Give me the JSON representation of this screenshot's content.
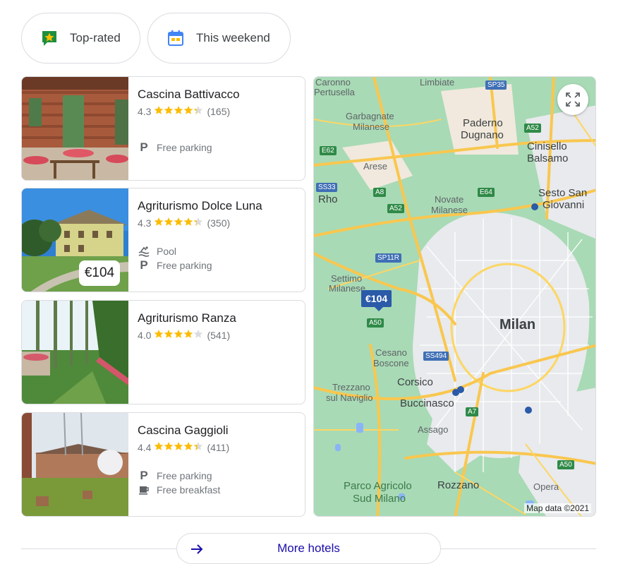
{
  "chips": [
    {
      "label": "Top-rated",
      "icon": "star-badge-icon"
    },
    {
      "label": "This weekend",
      "icon": "calendar-icon"
    }
  ],
  "hotels": [
    {
      "name": "Cascina Battivacco",
      "rating": "4.3",
      "stars": 4.3,
      "reviews": "(165)",
      "amenities": [
        {
          "icon": "parking-icon",
          "label": "Free parking"
        }
      ],
      "price": ""
    },
    {
      "name": "Agriturismo Dolce Luna",
      "rating": "4.3",
      "stars": 4.3,
      "reviews": "(350)",
      "amenities": [
        {
          "icon": "pool-icon",
          "label": "Pool"
        },
        {
          "icon": "parking-icon",
          "label": "Free parking"
        }
      ],
      "price": "€104"
    },
    {
      "name": "Agriturismo Ranza",
      "rating": "4.0",
      "stars": 4.0,
      "reviews": "(541)",
      "amenities": [],
      "price": ""
    },
    {
      "name": "Cascina Gaggioli",
      "rating": "4.4",
      "stars": 4.4,
      "reviews": "(411)",
      "amenities": [
        {
          "icon": "parking-icon",
          "label": "Free parking"
        },
        {
          "icon": "coffee-icon",
          "label": "Free breakfast"
        }
      ],
      "price": ""
    }
  ],
  "map": {
    "credit": "Map data ©2021",
    "price_marker": "€104",
    "labels": {
      "caronno": "Caronno",
      "pertusella": "Pertusella",
      "limbiate": "Limbiate",
      "garbagnate": "Garbagnate",
      "milanese1": "Milanese",
      "paderno": "Paderno",
      "dugnano": "Dugnano",
      "cinisello": "Cinisello",
      "balsamo": "Balsamo",
      "arese": "Arese",
      "sesto": "Sesto San",
      "giovanni": "Giovanni",
      "rho": "Rho",
      "novate": "Novate",
      "milanese2": "Milanese",
      "settimo": "Settimo",
      "milanese3": "Milanese",
      "milan": "Milan",
      "cesano": "Cesano",
      "boscone": "Boscone",
      "corsico": "Corsico",
      "trezzano": "Trezzano",
      "naviglio": "sul Naviglio",
      "buccinasco": "Buccinasco",
      "assago": "Assago",
      "parco1": "Parco Agricolo",
      "parco2": "Sud Milano",
      "rozzano": "Rozzano",
      "opera": "Opera"
    },
    "road_labels": {
      "sp35": "SP35",
      "a52a": "A52",
      "e62": "E62",
      "ss33": "SS33",
      "a8": "A8",
      "a52b": "A52",
      "e64": "E64",
      "sp11r": "SP11R",
      "a50a": "A50",
      "ss494": "SS494",
      "a7": "A7",
      "a50b": "A50"
    }
  },
  "more": {
    "label": "More hotels"
  },
  "colors": {
    "star": "#fbbc04",
    "star_empty": "#dadce0",
    "link": "#1a0dab",
    "road": "#fdd663",
    "map_green": "#a8dab5"
  }
}
